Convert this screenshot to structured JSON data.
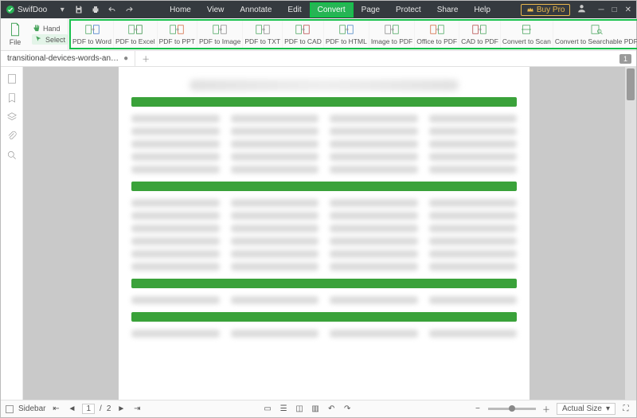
{
  "app": {
    "name": "SwifDoo"
  },
  "quick": {
    "undo_icon": "undo-icon",
    "redo_icon": "redo-icon",
    "save_icon": "save-icon",
    "print_icon": "print-icon"
  },
  "top_menu": {
    "items": [
      "Home",
      "View",
      "Annotate",
      "Edit",
      "Convert",
      "Page",
      "Protect",
      "Share",
      "Help"
    ],
    "active": "Convert"
  },
  "titlebar_right": {
    "buypro_label": "Buy Pro"
  },
  "ribbon_left": {
    "file_label": "File",
    "hand_label": "Hand",
    "select_label": "Select"
  },
  "convert_tools": [
    "PDF to Word",
    "PDF to Excel",
    "PDF to PPT",
    "PDF to Image",
    "PDF to TXT",
    "PDF to CAD",
    "PDF to HTML",
    "Image to PDF",
    "Office to PDF",
    "CAD to PDF",
    "Convert to Scan",
    "Convert to Searchable PDF"
  ],
  "document": {
    "tab_title": "transitional-devices-words-an…",
    "badge_page": "1"
  },
  "status": {
    "sidebar_label": "Sidebar",
    "current_page": "1",
    "page_sep": "/",
    "total_pages": "2",
    "fit_label": "Actual Size"
  }
}
